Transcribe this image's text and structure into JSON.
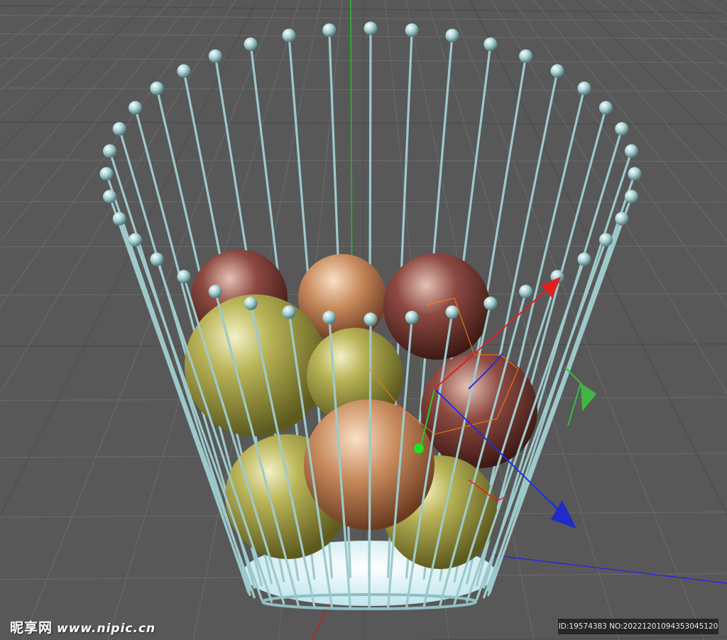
{
  "viewport": {
    "label": "3D viewport - apple wire basket render",
    "background_color": "#585858",
    "grid_color": "#6b6b6b",
    "grid_line_color_dark": "#4a4a4a"
  },
  "scene": {
    "wire_color": "#9ec9cb",
    "wire_highlight": "#d6f0f0",
    "bead_color": "#a9d2d4",
    "basket_bottom_color": "#e3f6fa",
    "apple_green": "#a7a34a",
    "apple_red": "#7a3a35",
    "apple_orange": "#c98a5a"
  },
  "gizmo": {
    "x_axis_color": "#e02020",
    "y_axis_color": "#20d020",
    "z_axis_color": "#2030e0",
    "selection_color": "#f08020"
  },
  "watermark": {
    "logo_cn": "昵享网",
    "site": "www.nipic.cn",
    "id_text": "ID:19574383 NO:20221201094353045120"
  }
}
